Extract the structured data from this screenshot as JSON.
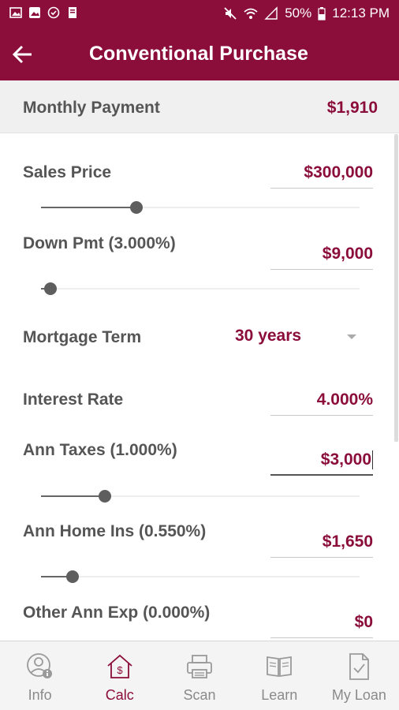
{
  "status_bar": {
    "battery": "50%",
    "time": "12:13 PM"
  },
  "header": {
    "title": "Conventional Purchase"
  },
  "summary": {
    "label": "Monthly Payment",
    "value": "$1,910"
  },
  "fields": {
    "sales_price": {
      "label": "Sales Price",
      "value": "$300,000",
      "slider_fraction": 0.3
    },
    "down_payment": {
      "label": "Down Pmt (3.000%)",
      "value": "$9,000",
      "slider_fraction": 0.03
    },
    "mortgage_term": {
      "label": "Mortgage Term",
      "value": "30 years"
    },
    "interest_rate": {
      "label": "Interest Rate",
      "value": "4.000%"
    },
    "annual_taxes": {
      "label": "Ann Taxes (1.000%)",
      "value": "$3,000",
      "slider_fraction": 0.2
    },
    "home_insurance": {
      "label": "Ann Home Ins (0.550%)",
      "value": "$1,650",
      "slider_fraction": 0.1
    },
    "other_expenses": {
      "label": "Other Ann Exp (0.000%)",
      "value": "$0"
    }
  },
  "bottom_nav": {
    "items": [
      {
        "label": "Info",
        "icon": "user-info-icon"
      },
      {
        "label": "Calc",
        "icon": "house-dollar-icon"
      },
      {
        "label": "Scan",
        "icon": "printer-icon"
      },
      {
        "label": "Learn",
        "icon": "book-icon"
      },
      {
        "label": "My Loan",
        "icon": "document-check-icon"
      }
    ],
    "active_index": 1
  },
  "colors": {
    "brand": "#8b0d3a",
    "label": "#555555",
    "nav_inactive": "#8a8a8a",
    "summary_bg": "#f0f0f0"
  }
}
